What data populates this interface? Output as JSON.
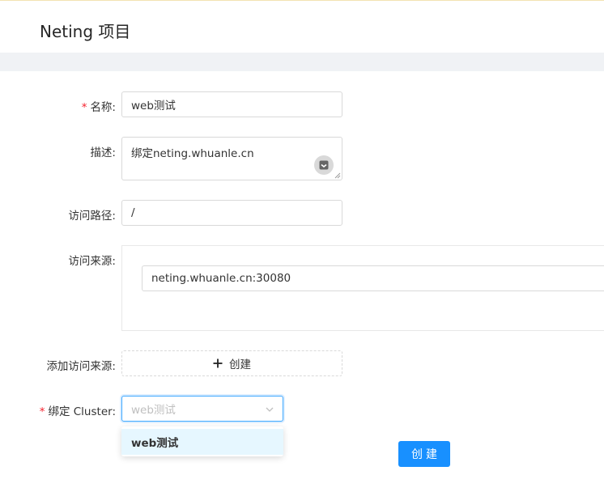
{
  "header": {
    "title": "Neting 项目"
  },
  "form": {
    "name": {
      "required_mark": "*",
      "label": "名称:",
      "value": "web测试"
    },
    "description": {
      "label": "描述:",
      "value": "绑定neting.whuanle.cn"
    },
    "path": {
      "label": "访问路径:",
      "value": "/"
    },
    "sources": {
      "label": "访问来源:",
      "items": [
        "neting.whuanle.cn:30080"
      ]
    },
    "add_source": {
      "label": "添加访问来源:",
      "button_label": "创建"
    },
    "cluster": {
      "required_mark": "*",
      "label": "绑定 Cluster:",
      "placeholder": "web测试",
      "options": [
        "web测试"
      ]
    },
    "submit_label": "创建"
  },
  "icons": {
    "textarea_action": "note-icon",
    "add": "plus-icon",
    "select_arrow": "chevron-down-icon"
  },
  "colors": {
    "primary": "#1890ff",
    "required": "#f5222d",
    "selected_option_bg": "#e6f7ff"
  }
}
